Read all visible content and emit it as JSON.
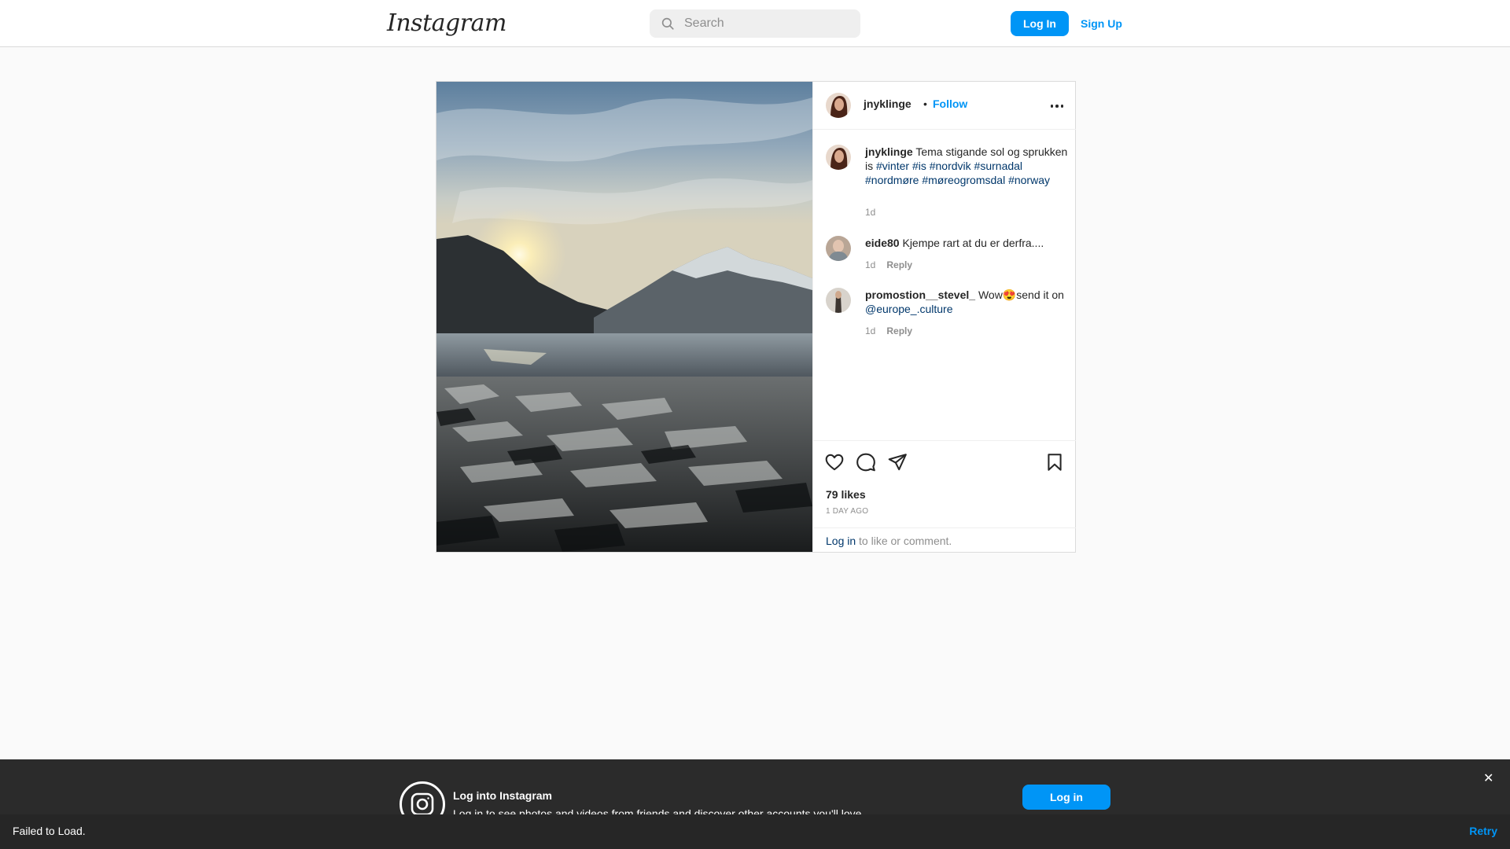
{
  "header": {
    "logo": "Instagram",
    "search_placeholder": "Search",
    "login_label": "Log In",
    "signup_label": "Sign Up"
  },
  "post": {
    "username": "jnyklinge",
    "separator": "•",
    "follow_label": "Follow",
    "caption": {
      "username": "jnyklinge",
      "text": "Tema stigande sol og sprukken is",
      "hashtags": [
        "#vinter",
        "#is",
        "#nordvik",
        "#surnadal",
        "#nordmøre",
        "#møreogromsdal",
        "#norway"
      ],
      "time": "1d"
    },
    "comments": [
      {
        "username": "eide80",
        "text": "Kjempe rart at du er derfra....",
        "time": "1d",
        "reply_label": "Reply"
      },
      {
        "username": "promostion__stevel_",
        "text": "Wow😍send it on",
        "mention": "@europe_.culture",
        "time": "1d",
        "reply_label": "Reply"
      }
    ],
    "likes": "79 likes",
    "posted_ago": "1 DAY AGO",
    "login_link": "Log in",
    "login_suffix": "to like or comment."
  },
  "banner": {
    "title": "Log into Instagram",
    "subtitle": "Log in to see photos and videos from friends and discover other accounts you'll love.",
    "login_label": "Log in",
    "close_glyph": "✕"
  },
  "toast": {
    "message": "Failed to Load.",
    "retry_label": "Retry"
  },
  "colors": {
    "accent": "#0095f6",
    "link": "#00376b",
    "muted": "#8e8e8e"
  }
}
